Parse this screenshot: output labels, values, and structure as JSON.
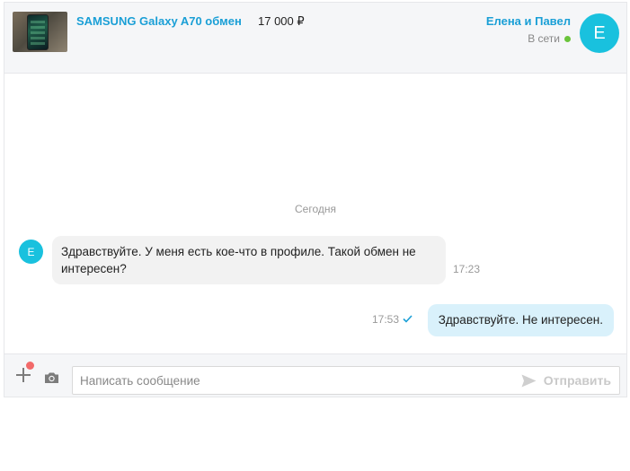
{
  "header": {
    "item_title": "SAMSUNG Galaxy A70 обмен",
    "item_price": "17 000 ₽",
    "user_name": "Елена и Павел",
    "status": "В сети",
    "avatar_letter": "Е"
  },
  "messages": {
    "date_separator": "Сегодня",
    "incoming": {
      "avatar_letter": "Е",
      "text": "Здравствуйте. У меня есть кое-что в профиле. Такой обмен не интересен?",
      "time": "17:23"
    },
    "outgoing": {
      "text": "Здравствуйте. Не интересен.",
      "time": "17:53",
      "read_icon": "check-icon"
    }
  },
  "composer": {
    "placeholder": "Написать сообщение",
    "send_label": "Отправить"
  },
  "colors": {
    "accent": "#1a9fd6",
    "avatar": "#19c1de",
    "online": "#6ac43b",
    "outgoing_bubble": "#d9f1fb",
    "incoming_bubble": "#f2f2f2",
    "notification": "#f26a6a"
  }
}
